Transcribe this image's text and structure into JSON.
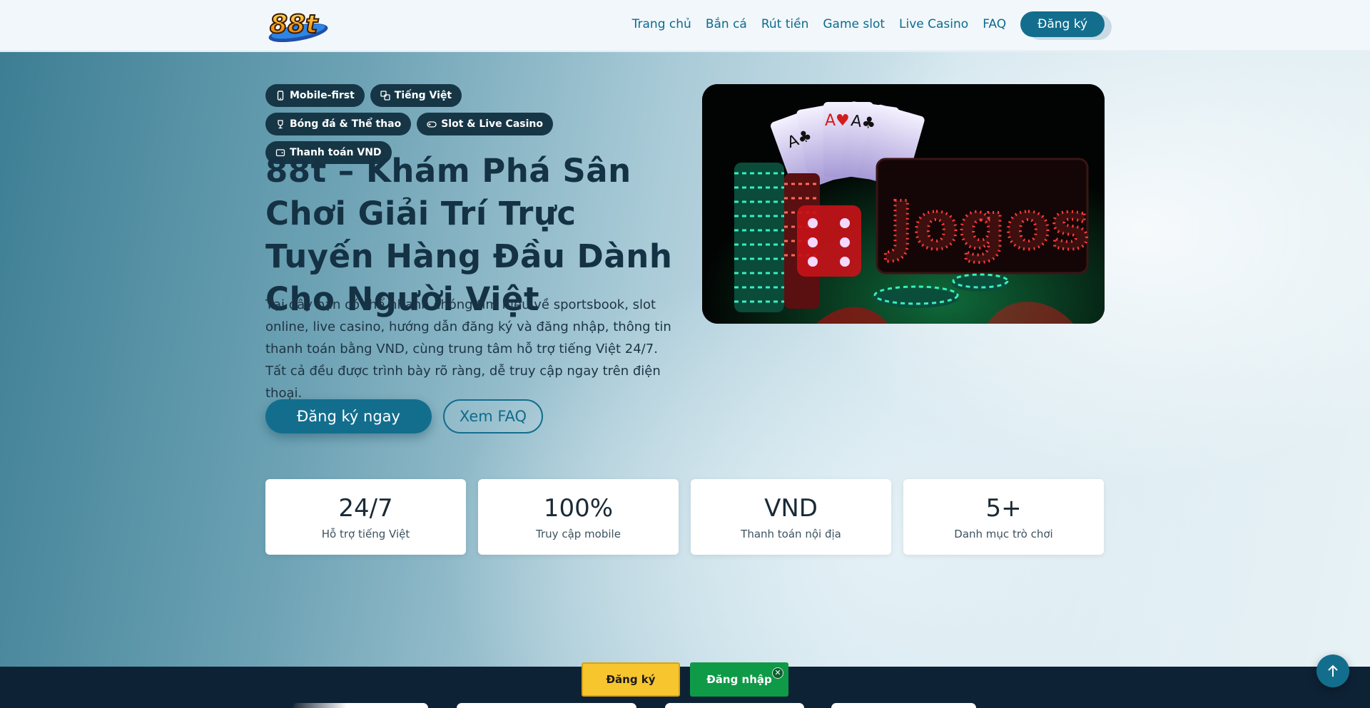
{
  "header": {
    "logo_text": "88t",
    "nav": [
      "Trang chủ",
      "Bắn cá",
      "Rút tiền",
      "Game slot",
      "Live Casino",
      "FAQ"
    ],
    "cta": "Đăng ký"
  },
  "hero": {
    "tags": [
      {
        "label": "Mobile-first",
        "icon": "phone-icon"
      },
      {
        "label": "Tiếng Việt",
        "icon": "translate-icon"
      },
      {
        "label": "Bóng đá & Thể thao",
        "icon": "trophy-icon"
      },
      {
        "label": "Slot & Live Casino",
        "icon": "gamepad-icon"
      },
      {
        "label": "Thanh toán VND",
        "icon": "wallet-icon"
      }
    ],
    "title": "88t – Khám Phá Sân Chơi Giải Trí Trực Tuyến Hàng Đầu Dành Cho Người Việt",
    "description": "Tại đây bạn có thể nhanh chóng tìm hiểu về sportsbook, slot online, live casino, hướng dẫn đăng ký và đăng nhập, thông tin thanh toán bằng VND, cùng trung tâm hỗ trợ tiếng Việt 24/7. Tất cả đều được trình bày rõ ràng, dễ truy cập ngay trên điện thoại.",
    "primary_button": "Đăng ký ngay",
    "secondary_button": "Xem FAQ",
    "image_sign_text": "Jogos"
  },
  "stats": [
    {
      "value": "24/7",
      "label": "Hỗ trợ tiếng Việt"
    },
    {
      "value": "100%",
      "label": "Truy cập mobile"
    },
    {
      "value": "VND",
      "label": "Thanh toán nội địa"
    },
    {
      "value": "5+",
      "label": "Danh mục trò chơi"
    }
  ],
  "floating": {
    "register": "Đăng ký",
    "login": "Đăng nhập",
    "close_icon": "close-icon",
    "back_to_top_icon": "arrow-up-icon"
  },
  "colors": {
    "primary": "#136e8e",
    "dark": "#163646",
    "yellow": "#f7c52e",
    "green": "#0f9a47",
    "footer": "#0e2236"
  }
}
